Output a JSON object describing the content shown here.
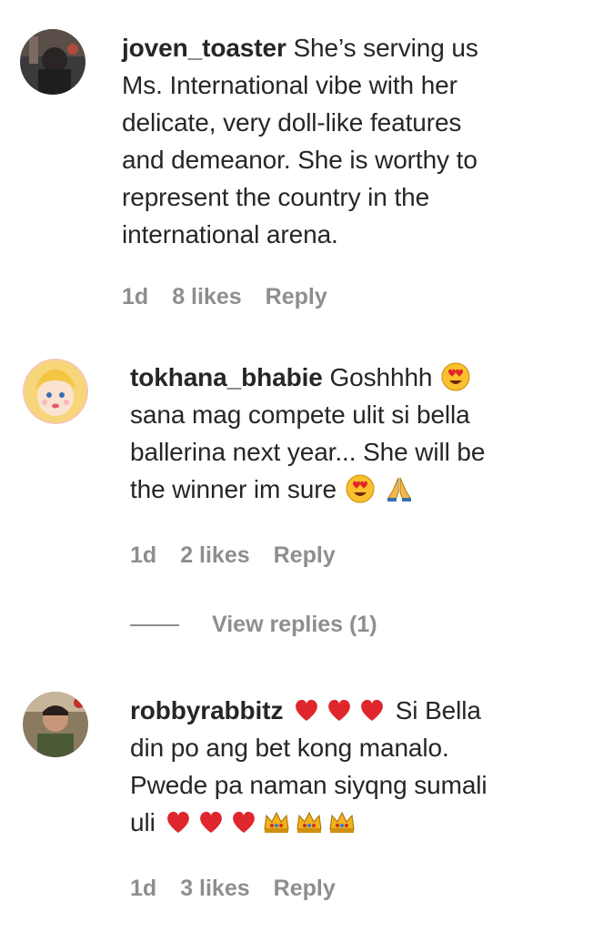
{
  "comments": [
    {
      "username": "joven_toaster",
      "line1": "She’s serving us",
      "line2": "Ms. International vibe with her",
      "line3": "delicate, very doll-like features",
      "line4": "and demeanor. She is worthy to",
      "line5": "represent the country in the",
      "line6": "international arena.",
      "time": "1d",
      "likes": "8 likes",
      "reply": "Reply",
      "avatar_icon": "dark-photo-avatar"
    },
    {
      "username": "tokhana_bhabie",
      "line1": "Goshhhh",
      "line2": "sana mag compete ulit si bella",
      "line3": "ballerina next year... She will be",
      "line4": "the winner im sure",
      "time": "1d",
      "likes": "2 likes",
      "reply": "Reply",
      "view_replies": "View replies (1)",
      "avatar_icon": "cartoon-girl-avatar"
    },
    {
      "username": "robbyrabbitz",
      "line1": "Si Bella",
      "line2": "din po ang bet kong manalo.",
      "line3": "Pwede pa naman siyqng sumali",
      "line4": "uli",
      "time": "1d",
      "likes": "3 likes",
      "reply": "Reply",
      "avatar_icon": "photo-avatar"
    }
  ],
  "colors": {
    "text": "#262626",
    "meta": "#8e8e8e",
    "heart": "#e0262d",
    "crown": "#f2b21c"
  }
}
